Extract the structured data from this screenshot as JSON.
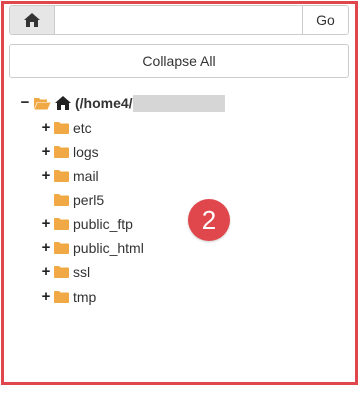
{
  "toolbar": {
    "home_icon": "home-icon",
    "path_value": "",
    "go_label": "Go"
  },
  "collapse_label": "Collapse All",
  "tree": {
    "root": {
      "toggle": "−",
      "label": "(/home4/",
      "icon": "open-folder-icon"
    },
    "items": [
      {
        "toggle": "+",
        "label": "etc"
      },
      {
        "toggle": "+",
        "label": "logs"
      },
      {
        "toggle": "+",
        "label": "mail"
      },
      {
        "toggle": "",
        "label": "perl5"
      },
      {
        "toggle": "+",
        "label": "public_ftp"
      },
      {
        "toggle": "+",
        "label": "public_html"
      },
      {
        "toggle": "+",
        "label": "ssl"
      },
      {
        "toggle": "+",
        "label": "tmp"
      }
    ]
  },
  "annotation_badge": "2",
  "colors": {
    "accent_red": "#e0474c",
    "folder_orange": "#f0a945"
  }
}
